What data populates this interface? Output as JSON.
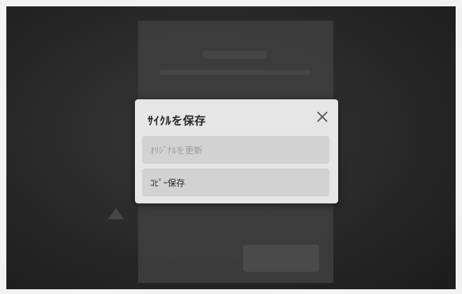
{
  "dialog": {
    "title": "ｻｲｸﾙを保存",
    "close_icon": "close-icon",
    "options": [
      {
        "label": "ｵﾘｼﾞﾅﾙを更新",
        "enabled": false
      },
      {
        "label": "ｺﾋﾟｰ保存",
        "enabled": true
      }
    ]
  }
}
